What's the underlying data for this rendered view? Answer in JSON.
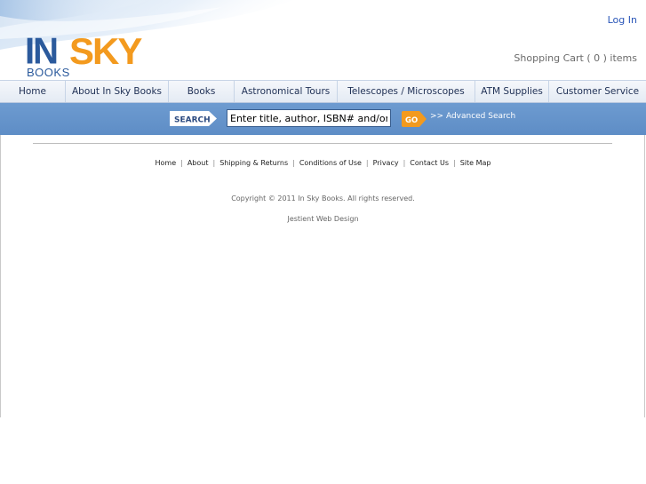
{
  "header": {
    "logo": {
      "word1": "IN",
      "word2": "SKY",
      "word3": "BOOKS"
    },
    "login_label": "Log In",
    "cart_text": "Shopping Cart ( 0 ) items"
  },
  "nav": {
    "items": [
      {
        "label": "Home"
      },
      {
        "label": "About In Sky Books"
      },
      {
        "label": "Books"
      },
      {
        "label": "Astronomical Tours"
      },
      {
        "label": "Telescopes / Microscopes"
      },
      {
        "label": "ATM Supplies"
      },
      {
        "label": "Customer Service"
      }
    ]
  },
  "search": {
    "label": "SEARCH",
    "placeholder": "Enter title, author, ISBN# and/or keywords",
    "value": "Enter title, author, ISBN# and/or keywords",
    "go_label": "GO",
    "advanced_label": ">> Advanced Search"
  },
  "footer": {
    "links": [
      {
        "label": "Home"
      },
      {
        "label": "About"
      },
      {
        "label": "Shipping & Returns"
      },
      {
        "label": "Conditions of Use"
      },
      {
        "label": "Privacy"
      },
      {
        "label": "Contact Us"
      },
      {
        "label": "Site Map"
      }
    ],
    "separator": "|",
    "copyright": "Copyright © 2011 In Sky Books. All rights reserved.",
    "designer": "Jestient Web Design"
  },
  "colors": {
    "brand_blue": "#2b5a9c",
    "brand_orange": "#f39a1e",
    "search_bar": "#6896cd",
    "link_blue": "#2a56b8"
  }
}
